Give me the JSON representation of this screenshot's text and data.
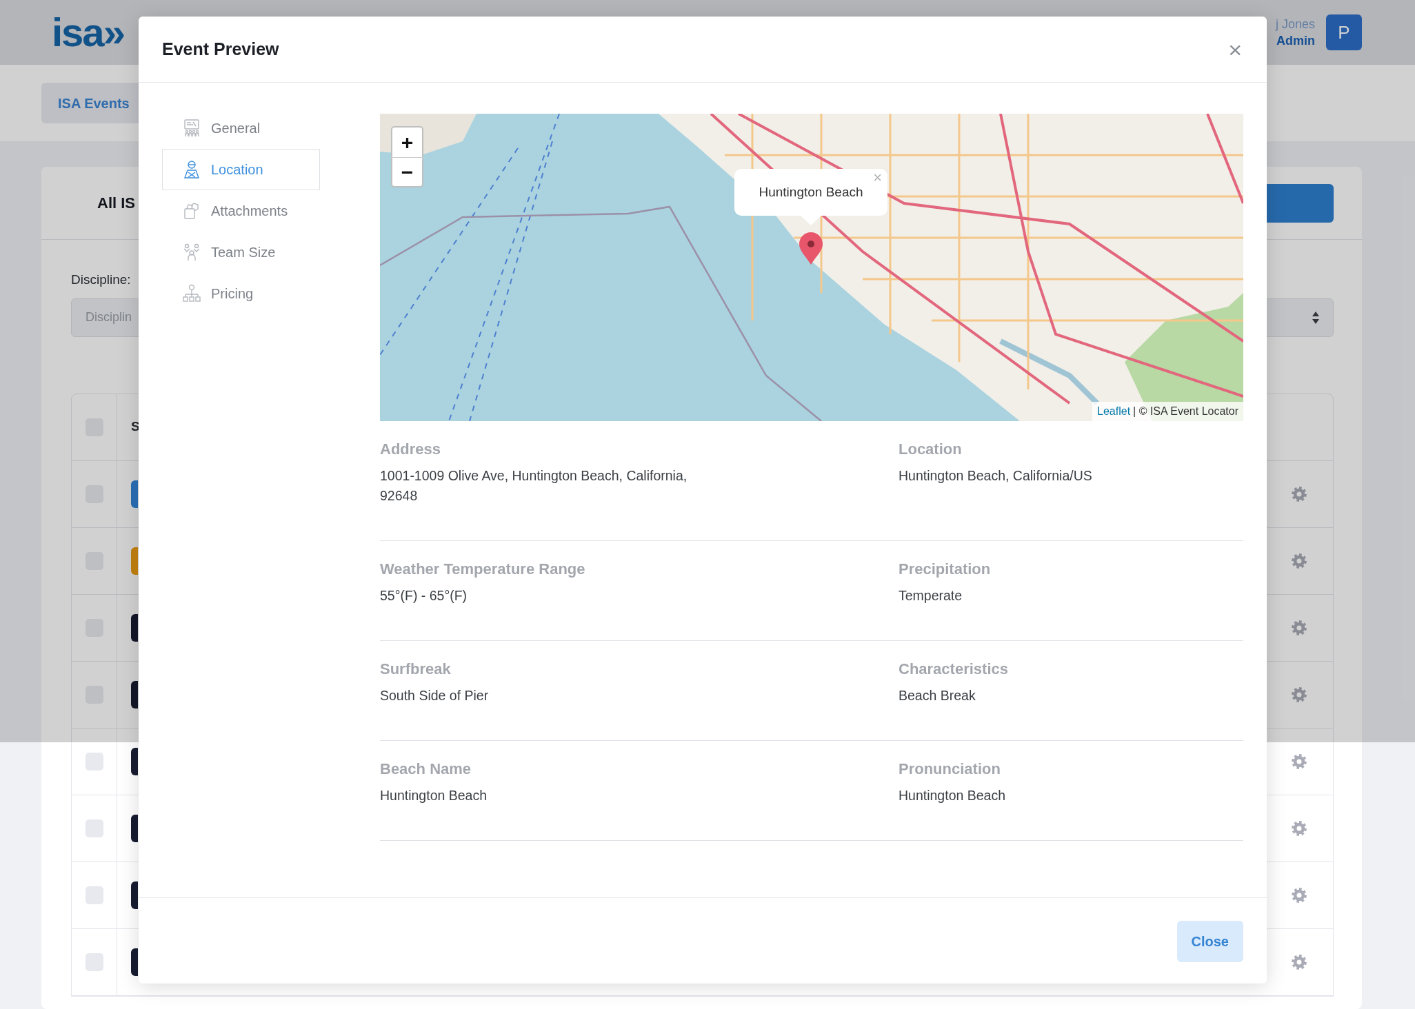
{
  "header": {
    "logo": "isa»",
    "user_name": "j Jones",
    "user_role": "Admin",
    "avatar_initial": "P"
  },
  "subnav": {
    "tabs": [
      {
        "label": "ISA Events",
        "selected": true
      }
    ]
  },
  "card": {
    "title": "All IS",
    "filter_label": "Discipline:",
    "filter_placeholder": "Disciplin",
    "table": {
      "column_2": "S",
      "select_all_checked": false,
      "rows": [
        {
          "color": "#2769ab",
          "checked": false
        },
        {
          "color": "#b87a0c",
          "checked": false
        },
        {
          "color": "#121526",
          "checked": false
        },
        {
          "color": "#121526",
          "checked": false
        },
        {
          "color": "#161a2e",
          "checked": false
        },
        {
          "color": "#161a2e",
          "checked": false
        },
        {
          "color": "#161a2e",
          "checked": false
        },
        {
          "color": "#161a2e",
          "checked": false
        }
      ]
    }
  },
  "modal": {
    "title": "Event Preview",
    "close": "×",
    "nav": [
      {
        "label": "General",
        "selected": false
      },
      {
        "label": "Location",
        "selected": true
      },
      {
        "label": "Attachments",
        "selected": false
      },
      {
        "label": "Team Size",
        "selected": false
      },
      {
        "label": "Pricing",
        "selected": false
      }
    ],
    "map": {
      "zoom_in": "+",
      "zoom_out": "−",
      "popup": "Huntington Beach",
      "popup_close": "×",
      "attribution_link": "Leaflet",
      "attribution": "| © ISA Event Locator"
    },
    "sections": [
      {
        "items": [
          {
            "label": "Address",
            "value": "1001-1009 Olive Ave, Huntington Beach, California, 92648"
          },
          {
            "label": "Location",
            "value": "Huntington Beach, California/US"
          }
        ]
      },
      {
        "items": [
          {
            "label": "Weather Temperature Range",
            "value": "55°(F) - 65°(F)"
          },
          {
            "label": "Precipitation",
            "value": "Temperate"
          }
        ]
      },
      {
        "items": [
          {
            "label": "Surfbreak",
            "value": "South Side of Pier"
          },
          {
            "label": "Characteristics",
            "value": "Beach Break"
          }
        ]
      },
      {
        "items": [
          {
            "label": "Beach Name",
            "value": "Huntington Beach"
          },
          {
            "label": "Pronunciation",
            "value": "Huntington Beach"
          }
        ]
      }
    ],
    "footer_button": "Close"
  }
}
